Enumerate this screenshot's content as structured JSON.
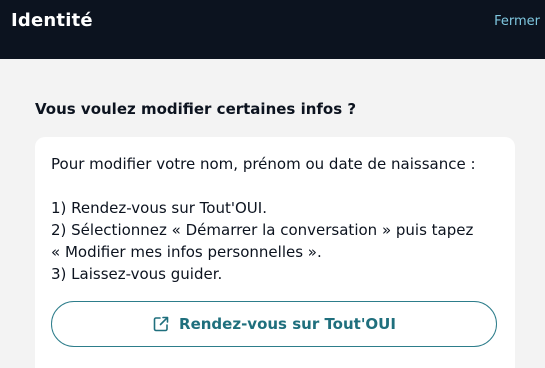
{
  "header": {
    "title": "Identité",
    "close_label": "Fermer"
  },
  "section": {
    "title": "Vous voulez modifier certaines infos ?"
  },
  "card": {
    "intro": "Pour modifier votre nom, prénom ou date de naissance :",
    "steps": [
      "1) Rendez-vous sur Tout'OUI.",
      "2) Sélectionnez « Démarrer la conversation » puis tapez",
      "« Modifier mes infos personnelles ».",
      "3) Laissez-vous guider."
    ],
    "cta_label": "Rendez-vous sur Tout'OUI",
    "cta_icon": "external-link-icon"
  },
  "colors": {
    "header_bg": "#0c131f",
    "accent": "#1f6f7d",
    "close_link": "#7fc7df",
    "page_bg": "#f3f3f3"
  }
}
